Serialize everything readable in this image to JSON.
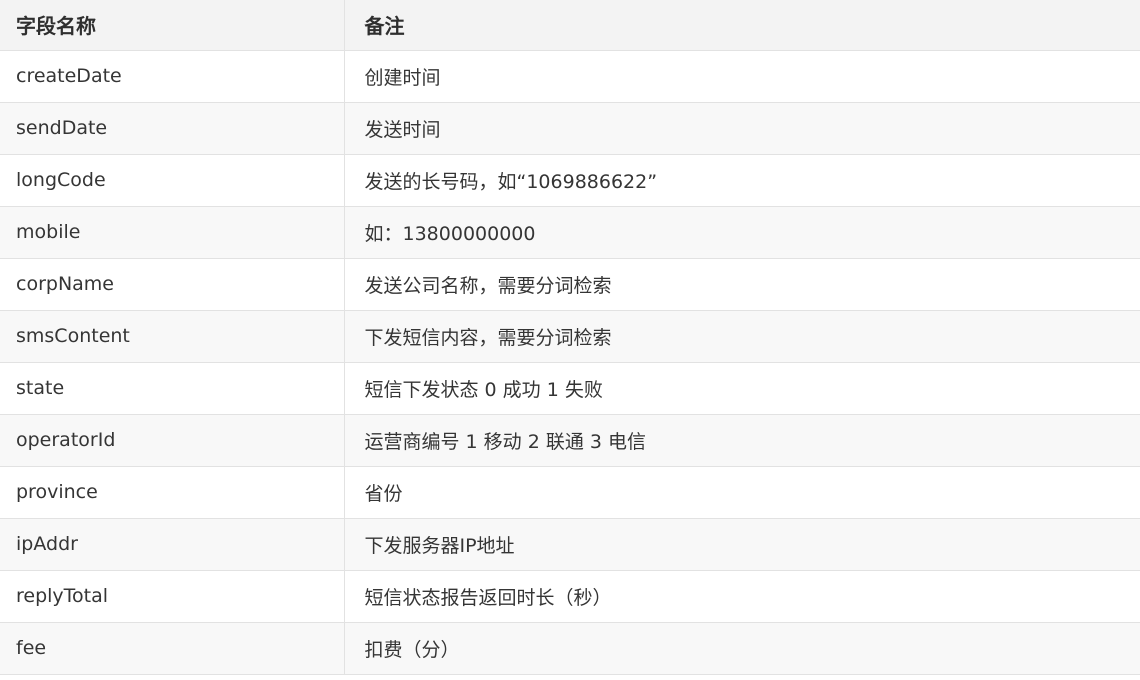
{
  "table": {
    "headers": [
      "字段名称",
      "备注"
    ],
    "rows": [
      {
        "field": "createDate",
        "note": "创建时间"
      },
      {
        "field": "sendDate",
        "note": "发送时间"
      },
      {
        "field": "longCode",
        "note": "发送的长号码，如“1069886622”"
      },
      {
        "field": "mobile",
        "note": "如：13800000000"
      },
      {
        "field": "corpName",
        "note": "发送公司名称，需要分词检索"
      },
      {
        "field": "smsContent",
        "note": "下发短信内容，需要分词检索"
      },
      {
        "field": "state",
        "note": "短信下发状态 0 成功 1 失败"
      },
      {
        "field": "operatorId",
        "note": "运营商编号 1 移动 2 联通 3 电信"
      },
      {
        "field": "province",
        "note": "省份"
      },
      {
        "field": "ipAddr",
        "note": "下发服务器IP地址"
      },
      {
        "field": "replyTotal",
        "note": "短信状态报告返回时长（秒）"
      },
      {
        "field": "fee",
        "note": "扣费（分）"
      }
    ]
  }
}
